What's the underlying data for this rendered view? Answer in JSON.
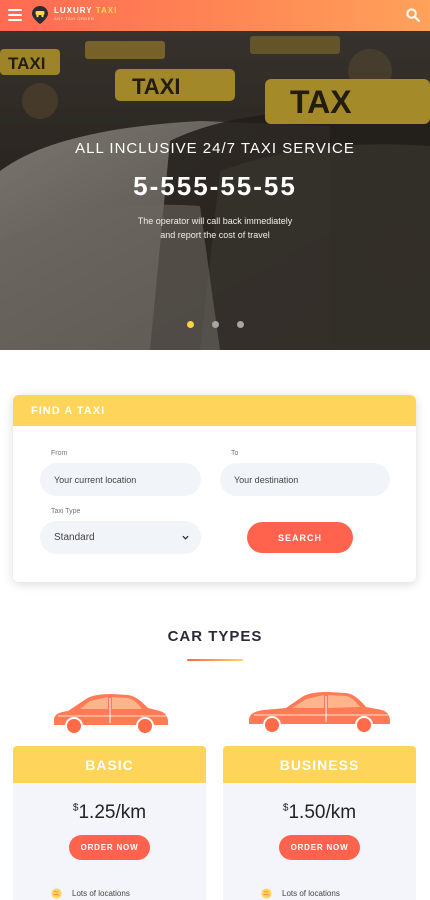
{
  "header": {
    "logo_main": "LUXURY",
    "logo_accent": "TAXI",
    "logo_tagline": "ANY TAXI ORDER",
    "menu_icon": "hamburger-icon",
    "search_icon": "search-icon"
  },
  "hero": {
    "title": "ALL INCLUSIVE 24/7 TAXI SERVICE",
    "phone": "5-555-55-55",
    "subtitle_line1": "The operator will call back immediately",
    "subtitle_line2": "and report the cost of travel",
    "slides": 3,
    "active_slide": 1
  },
  "find_taxi": {
    "heading": "FIND A TAXI",
    "from_label": "From",
    "from_value": "Your current location",
    "to_label": "To",
    "to_value": "Your destination",
    "type_label": "Taxi Type",
    "type_value": "Standard",
    "search_label": "SEARCH"
  },
  "car_types": {
    "title": "CAR TYPES",
    "plans": [
      {
        "name": "BASIC",
        "currency": "$",
        "price": "1.25/km",
        "order_label": "ORDER NOW",
        "feature": "Lots of locations"
      },
      {
        "name": "BUSINESS",
        "currency": "$",
        "price": "1.50/km",
        "order_label": "ORDER NOW",
        "feature": "Lots of locations"
      }
    ]
  },
  "colors": {
    "accent_red": "#ff634d",
    "accent_yellow": "#ffd45a",
    "header_gradient_start": "#ff6a52",
    "header_gradient_end": "#ffa25a"
  }
}
